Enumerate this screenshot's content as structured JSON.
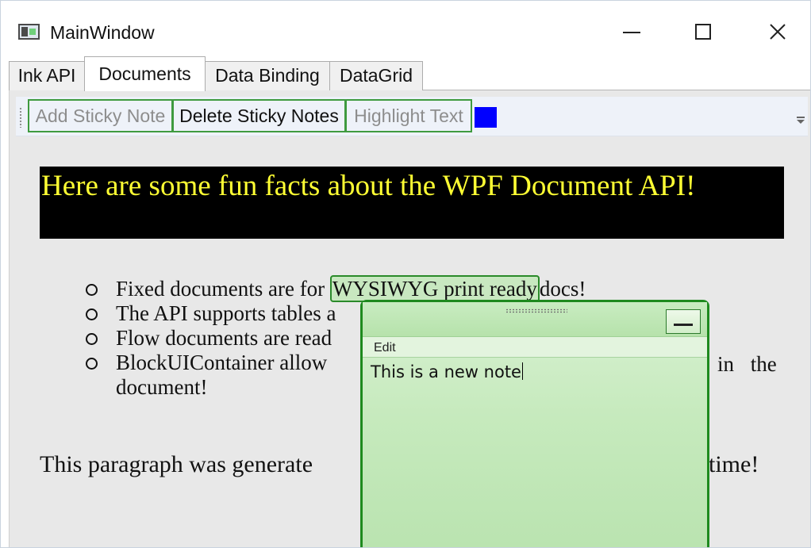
{
  "window": {
    "title": "MainWindow",
    "icon": "window-app-icon",
    "controls": {
      "minimize": "minimize-icon",
      "maximize": "maximize-icon",
      "close": "close-icon"
    }
  },
  "tabs": [
    {
      "label": "Ink API",
      "active": false
    },
    {
      "label": "Documents",
      "active": true
    },
    {
      "label": "Data Binding",
      "active": false
    },
    {
      "label": "DataGrid",
      "active": false
    }
  ],
  "toolbar": {
    "add_sticky_note": "Add Sticky Note",
    "delete_sticky_notes": "Delete Sticky Notes",
    "highlight_text": "Highlight Text",
    "highlight_color": "#0000ff"
  },
  "document": {
    "heading": "Here are some fun facts about the WPF Document API!",
    "bullets": {
      "b1_before": "Fixed documents are for ",
      "b1_highlight": "WYSIWYG print ready",
      "b1_after": "docs!",
      "b2": "The API supports tables a",
      "b3": "Flow documents are read",
      "b4_start": "BlockUIContainer allow",
      "b4_end": "in the",
      "b4_cont": "document!"
    },
    "paragraph_start": "This paragraph was generate",
    "paragraph_end": "ntime!"
  },
  "sticky_note": {
    "menu_edit": "Edit",
    "text": "This is a new note",
    "border_color": "#1e8a1e",
    "fill_color": "#c6eabd"
  }
}
